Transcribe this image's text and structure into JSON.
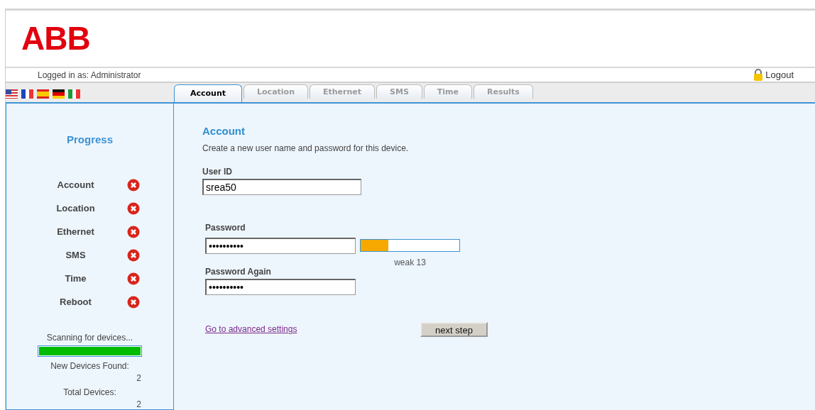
{
  "logo": "ABB",
  "user_bar": {
    "logged_in": "Logged in as: Administrator",
    "logout": "Logout"
  },
  "languages": [
    {
      "kind": "us"
    },
    {
      "kind": "fr"
    },
    {
      "kind": "es"
    },
    {
      "kind": "de"
    },
    {
      "kind": "it"
    }
  ],
  "tabs": [
    {
      "label": "Account",
      "selected": true
    },
    {
      "label": "Location",
      "selected": false
    },
    {
      "label": "Ethernet",
      "selected": false
    },
    {
      "label": "SMS",
      "selected": false
    },
    {
      "label": "Time",
      "selected": false
    },
    {
      "label": "Results",
      "selected": false
    }
  ],
  "sidebar": {
    "title": "Progress",
    "steps": [
      {
        "label": "Account",
        "done": false
      },
      {
        "label": "Location",
        "done": false
      },
      {
        "label": "Ethernet",
        "done": false
      },
      {
        "label": "SMS",
        "done": false
      },
      {
        "label": "Time",
        "done": false
      },
      {
        "label": "Reboot",
        "done": false
      }
    ],
    "scan": {
      "label": "Scanning for devices...",
      "level": 1.0
    },
    "new_devices_label": "New Devices Found:",
    "new_devices": "2",
    "total_devices_label": "Total Devices:",
    "total_devices": "2"
  },
  "form": {
    "title": "Account",
    "description": "Create a new user name and password for this device.",
    "user_id": {
      "label": "User ID",
      "value": "srea50"
    },
    "password": {
      "label": "Password",
      "value": "••••••••••"
    },
    "strength": {
      "level": 0.28,
      "reading": "weak 13"
    },
    "password_again": {
      "label": "Password Again",
      "value": "••••••••••"
    },
    "advanced_link": "Go to advanced settings",
    "next_button": "next step"
  }
}
